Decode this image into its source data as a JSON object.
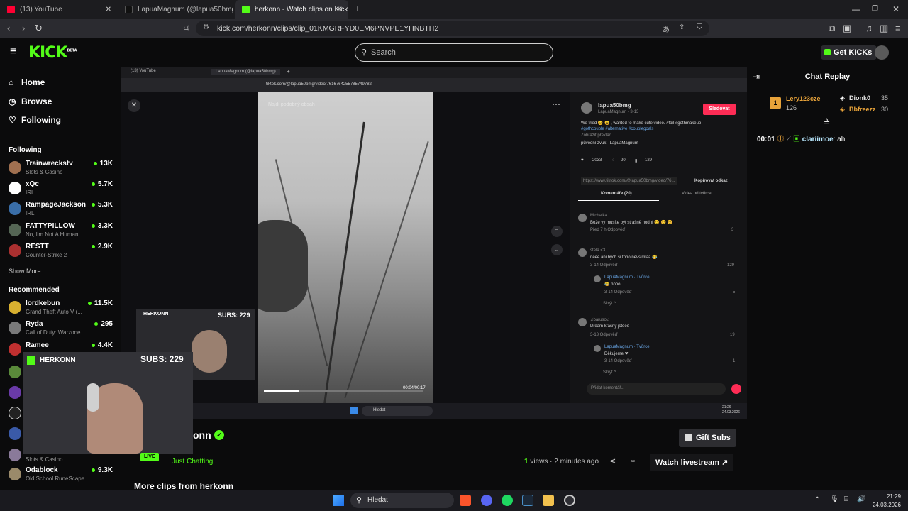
{
  "browser": {
    "tabs": [
      {
        "title": "(13) YouTube",
        "color": "#ff0033"
      },
      {
        "title": "LapuaMagnum (@lapua50bmg) | TikTok",
        "color": "#111111"
      },
      {
        "title": "herkonn - Watch clips on Kick",
        "color": "#53fc18"
      }
    ],
    "new_tab": "+",
    "url": "kick.com/herkonn/clips/clip_01KMGRFYD0EM6PNVPE1YHNBTH2"
  },
  "header": {
    "logo": "KICK",
    "logo_sup": "BETA",
    "search_placeholder": "Search",
    "get_kicks": "Get KICKs"
  },
  "sidebar": {
    "nav": [
      {
        "label": "Home",
        "icon": "home-icon"
      },
      {
        "label": "Browse",
        "icon": "compass-icon"
      },
      {
        "label": "Following",
        "icon": "heart-icon"
      }
    ],
    "following_title": "Following",
    "following": [
      {
        "name": "Trainwreckstv",
        "category": "Slots & Casino",
        "viewers": "13K",
        "color": "#a07050"
      },
      {
        "name": "xQc",
        "category": "IRL",
        "viewers": "5.7K",
        "color": "#ffffff"
      },
      {
        "name": "RampageJackson",
        "category": "IRL",
        "viewers": "5.3K",
        "color": "#3a6ea8"
      },
      {
        "name": "FATTYPILLOW",
        "category": "No, I'm Not A Human",
        "viewers": "3.3K",
        "color": "#556655"
      },
      {
        "name": "RESTT",
        "category": "Counter-Strike 2",
        "viewers": "2.9K",
        "color": "#aa3030"
      }
    ],
    "show_more": "Show More",
    "recommended_title": "Recommended",
    "recommended": [
      {
        "name": "lordkebun",
        "category": "Grand Theft Auto V (...",
        "viewers": "11.5K",
        "color": "#d8b030"
      },
      {
        "name": "Ryda",
        "category": "Call of Duty: Warzone",
        "viewers": "295",
        "color": "#7a7a7a"
      },
      {
        "name": "Ramee",
        "category": "",
        "viewers": "4.4K",
        "color": "#c03030"
      },
      {
        "name": "",
        "category": "Slots & Casino",
        "viewers": "",
        "color": "#8a7a9a"
      },
      {
        "name": "Odablock",
        "category": "Old School RuneScape",
        "viewers": "9.3K",
        "color": "#9a8a6a"
      }
    ]
  },
  "player": {
    "inner_tabs": [
      "(13) YouTube",
      "LapuaMagnum (@lapua50bmg)",
      "+"
    ],
    "inner_url": "tiktok.com/@lapua50bmg/video/7616764255785749782",
    "video_overlay_text": "Najdi podobný obsah",
    "video_time": "00:04/00:17",
    "tiktok": {
      "username": "lapua50bmg",
      "display": "LapuaMagnum · 3-13",
      "follow": "Sledovat",
      "caption": "We tried 😊 😄 , wanted to make cute video. #fail #gothmakeup",
      "tags": "#gothcouple #alternative #couplegoals",
      "translate": "Zobrazit překlad",
      "sound": "původní zvuk - LapuaMagnum",
      "likes": "2033",
      "comments_count": "20",
      "saves": "129",
      "link": "https://www.tiktok.com/@lapua50bmg/video/76...",
      "copy_link": "Kopírovat odkaz",
      "tab_comments": "Komentáře (20)",
      "tab_creator": "Videa od tvůrce",
      "comments": [
        {
          "user": "Michalka",
          "text": "Bože vy musíte být strašně hodní 😊 😊 😊",
          "meta": "Před 7 h   Odpověď",
          "likes": "3"
        },
        {
          "user": "stela <3",
          "text": "neee ani bych si toho nevsimlaa 😂",
          "meta": "3-14   Odpověď",
          "likes": "129"
        },
        {
          "user": "LapuaMagnum · Tvůrce",
          "text": "😂 nooo",
          "meta": "3-14   Odpověď",
          "likes": "5"
        },
        {
          "user": "♫baruso♫",
          "text": "Dream krásný jsteee",
          "meta": "3-13   Odpověď",
          "likes": "19"
        },
        {
          "user": "LapuaMagnum · Tvůrce",
          "text": "Děkujeme ❤",
          "meta": "3-14   Odpověď",
          "likes": "1"
        }
      ],
      "hide": "Skrýt ^",
      "add_comment": "Přidat komentář..."
    },
    "inner_taskbar_search": "Hledat",
    "inner_clock": "21:26\n24.03.2026",
    "cam_small_label": "HERKONN",
    "cam_small_subs": "SUBS: 229",
    "cam_big_label": "HERKONN",
    "cam_big_subs": "SUBS: 229"
  },
  "clip": {
    "channel_name": "onn",
    "live_badge": "LIVE",
    "category": "Just Chatting",
    "views_count": "1",
    "views_label": " views · 2 minutes ago",
    "gift_subs": "Gift Subs",
    "watch_livestream": "Watch livestream",
    "more_clips": "More clips from herkonn"
  },
  "chat": {
    "title": "Chat Replay",
    "leaderboard": [
      {
        "rank": "1",
        "name": "Lery123cze",
        "count": "126",
        "color": "#e8a33a"
      },
      {
        "name": "Dionk0",
        "count": "35",
        "color": "#e8e8e8"
      },
      {
        "name": "Bbfreezz",
        "count": "30",
        "color": "#e8a33a"
      }
    ],
    "message_time": "00:01",
    "message_user": "clariimoe",
    "message_text": ": ah"
  },
  "taskbar": {
    "search": "Hledat",
    "time": "21:29",
    "date": "24.03.2026"
  }
}
